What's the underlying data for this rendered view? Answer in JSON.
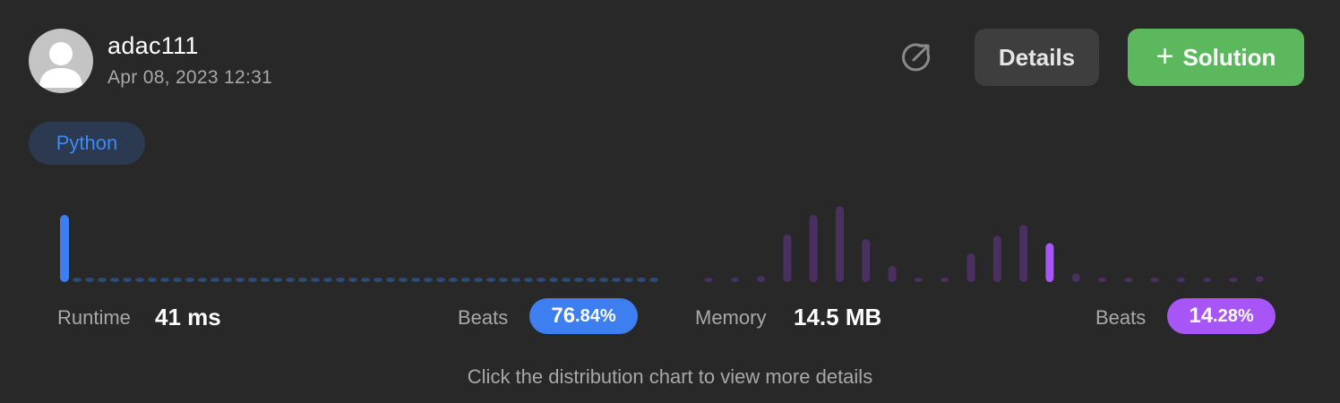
{
  "user": {
    "name": "adac111",
    "timestamp": "Apr 08, 2023 12:31"
  },
  "actions": {
    "share_icon": "share-icon",
    "details_label": "Details",
    "solution_label": "Solution",
    "solution_icon": "plus-icon"
  },
  "language": "Python",
  "stats": {
    "runtime": {
      "label": "Runtime",
      "value": "41 ms",
      "beats_label": "Beats",
      "beats_int": "76",
      "beats_dec": ".84%"
    },
    "memory": {
      "label": "Memory",
      "value": "14.5 MB",
      "beats_label": "Beats",
      "beats_int": "14",
      "beats_dec": ".28%"
    }
  },
  "hint": "Click the distribution chart to view more details",
  "colors": {
    "background": "#282828",
    "runtime_accent": "#3d7ef0",
    "memory_accent": "#a855f7",
    "solution_button": "#5cb85c",
    "details_button": "#3e3e3e"
  },
  "chart_data": [
    {
      "type": "bar",
      "name": "runtime-distribution",
      "values": [
        1.0,
        0.03,
        0.03,
        0.03,
        0.03,
        0.03,
        0.03,
        0.03,
        0.03,
        0.03,
        0.03,
        0.03,
        0.03,
        0.03,
        0.03,
        0.03,
        0.03,
        0.03,
        0.03,
        0.03,
        0.03,
        0.03,
        0.03,
        0.03,
        0.03,
        0.03,
        0.03,
        0.03,
        0.03,
        0.03,
        0.03,
        0.03,
        0.03,
        0.03,
        0.03,
        0.03,
        0.03,
        0.03,
        0.03,
        0.03,
        0.03,
        0.03,
        0.03,
        0.03,
        0.03,
        0.03,
        0.03,
        0.03
      ],
      "highlight_index": 0
    },
    {
      "type": "bar",
      "name": "memory-distribution",
      "values": [
        0.04,
        0.04,
        0.09,
        0.71,
        1.0,
        1.13,
        0.64,
        0.24,
        0.04,
        0.04,
        0.43,
        0.69,
        0.85,
        0.58,
        0.13,
        0.04,
        0.04,
        0.04,
        0.04,
        0.04,
        0.06,
        0.09
      ],
      "highlight_index": 13
    }
  ]
}
